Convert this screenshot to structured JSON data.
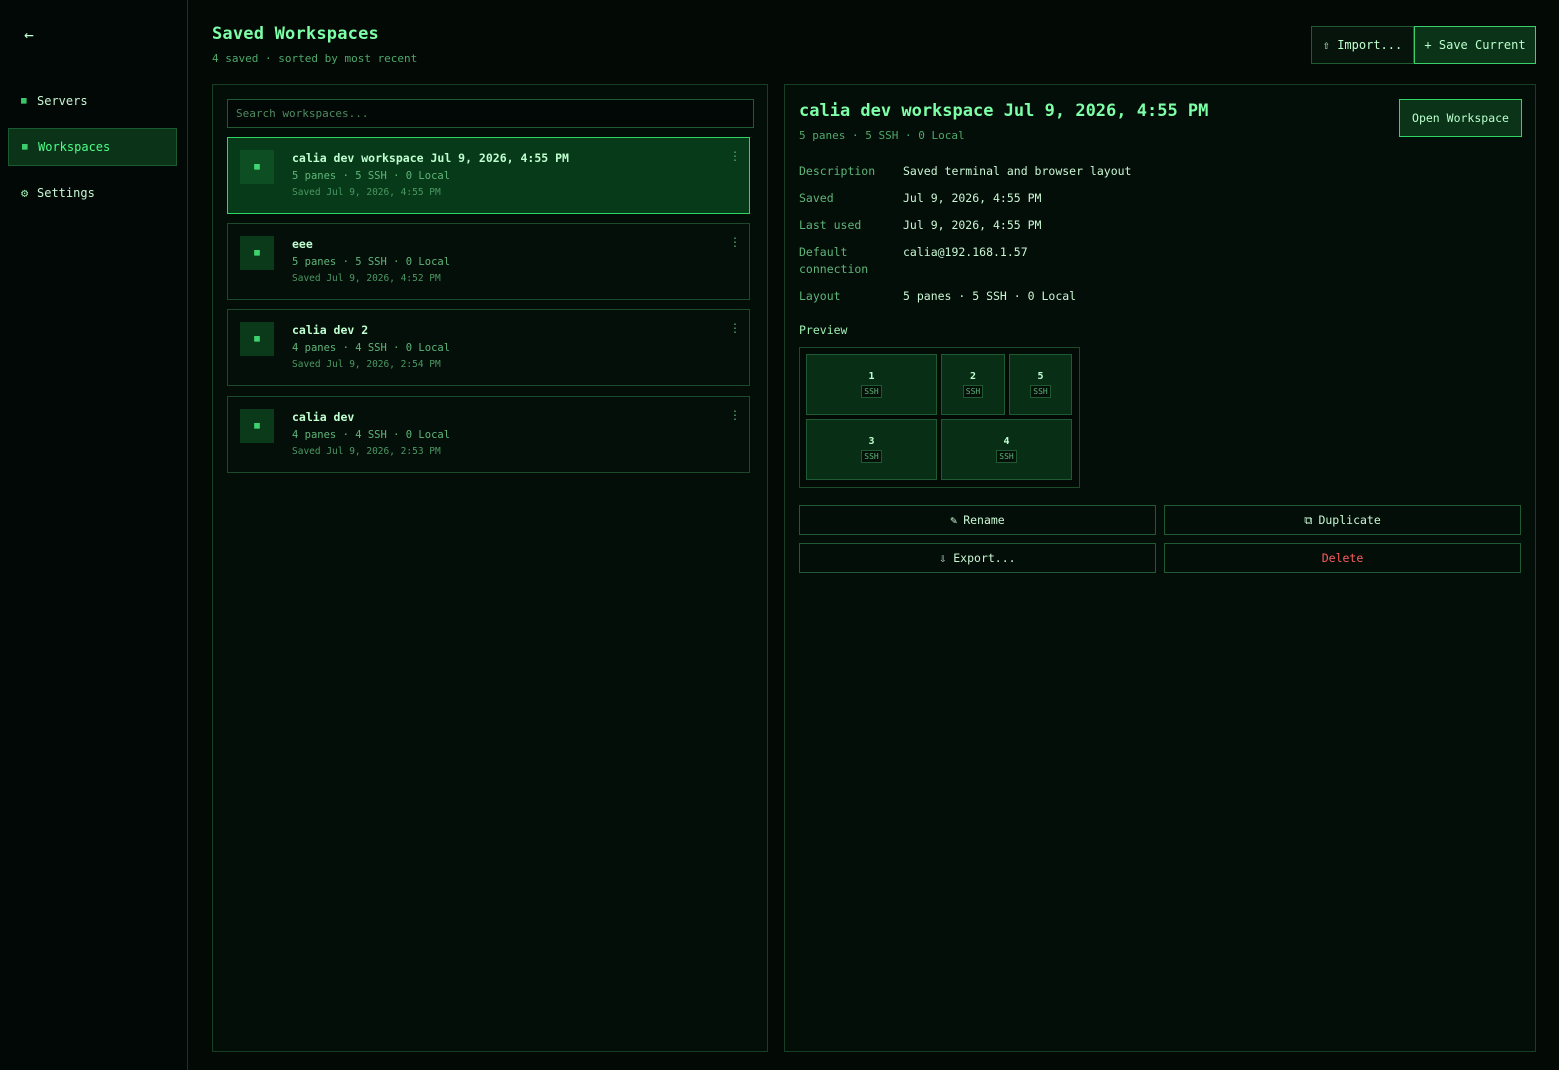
{
  "sidebar": {
    "back_icon": "←",
    "items": [
      {
        "label": "Servers",
        "icon": "▦"
      },
      {
        "label": "Workspaces",
        "icon": "▦"
      },
      {
        "label": "Settings",
        "icon": "⚙"
      }
    ]
  },
  "header": {
    "title": "Saved Workspaces",
    "subtitle": "4 saved · sorted by most recent",
    "import_label": "⇧ Import...",
    "save_label": "+ Save Current"
  },
  "list": {
    "search_placeholder": "Search workspaces...",
    "items": [
      {
        "name": "calia dev workspace Jul 9, 2026, 4:55 PM",
        "meta": "5 panes · 5 SSH · 0 Local",
        "saved": "Saved Jul 9, 2026, 4:55 PM",
        "icon": "▦",
        "menu": "⋮"
      },
      {
        "name": "eee",
        "meta": "5 panes · 5 SSH · 0 Local",
        "saved": "Saved Jul 9, 2026, 4:52 PM",
        "icon": "▦",
        "menu": "⋮"
      },
      {
        "name": "calia dev 2",
        "meta": "4 panes · 4 SSH · 0 Local",
        "saved": "Saved Jul 9, 2026, 2:54 PM",
        "icon": "▦",
        "menu": "⋮"
      },
      {
        "name": "calia dev",
        "meta": "4 panes · 4 SSH · 0 Local",
        "saved": "Saved Jul 9, 2026, 2:53 PM",
        "icon": "▦",
        "menu": "⋮"
      }
    ]
  },
  "detail": {
    "title": "calia dev workspace Jul 9, 2026, 4:55 PM",
    "subtitle": "5 panes · 5 SSH · 0 Local",
    "open_label": "Open Workspace",
    "props": [
      {
        "key": "Description",
        "value": "Saved terminal and browser layout"
      },
      {
        "key": "Saved",
        "value": "Jul 9, 2026, 4:55 PM"
      },
      {
        "key": "Last used",
        "value": "Jul 9, 2026, 4:55 PM"
      },
      {
        "key": "Default connection",
        "value": "calia@192.168.1.57"
      },
      {
        "key": "Layout",
        "value": "5 panes · 5 SSH · 0 Local"
      }
    ],
    "preview_label": "Preview",
    "panes": [
      {
        "num": "1",
        "tag": "SSH"
      },
      {
        "num": "2",
        "tag": "SSH"
      },
      {
        "num": "5",
        "tag": "SSH"
      },
      {
        "num": "3",
        "tag": "SSH"
      },
      {
        "num": "4",
        "tag": "SSH"
      }
    ],
    "actions": {
      "rename": "Rename",
      "rename_icon": "✎",
      "duplicate": "Duplicate",
      "duplicate_icon": "⧉",
      "export": "⇩ Export...",
      "delete": "Delete"
    }
  }
}
